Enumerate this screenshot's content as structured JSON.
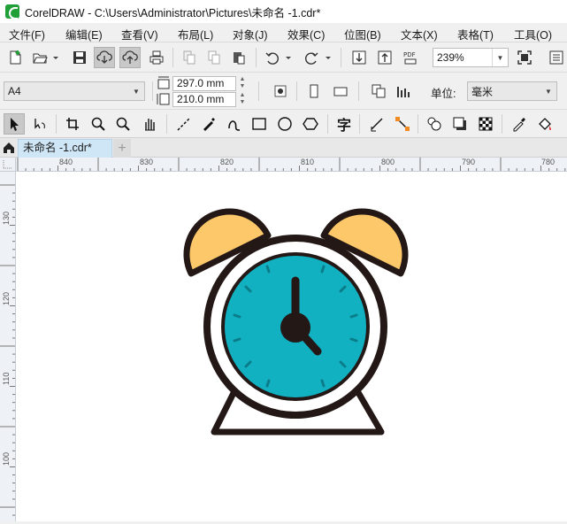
{
  "window": {
    "title": "CorelDRAW - C:\\Users\\Administrator\\Pictures\\未命名 -1.cdr*"
  },
  "menu": [
    "文件(F)",
    "编辑(E)",
    "查看(V)",
    "布局(L)",
    "对象(J)",
    "效果(C)",
    "位图(B)",
    "文本(X)",
    "表格(T)",
    "工具(O)"
  ],
  "standard_toolbar": {
    "zoom": "239%"
  },
  "property_bar": {
    "page_size": "A4",
    "width": "297.0 mm",
    "height": "210.0 mm",
    "units_label": "单位:",
    "units_value": "毫米"
  },
  "toolbox": {
    "text_tool_glyph": "字"
  },
  "tabs": {
    "document": "未命名 -1.cdr*",
    "add": "+"
  },
  "rulers": {
    "horizontal": [
      "840",
      "830",
      "820",
      "810",
      "800",
      "790",
      "780"
    ],
    "vertical": [
      "130",
      "120",
      "110",
      "100"
    ]
  },
  "drawing": {
    "subject": "alarm clock",
    "colors": {
      "outline": "#231815",
      "bells": "#fdc86a",
      "face": "#12b1c2",
      "body": "#ffffff",
      "tick": "#0b7c89"
    }
  }
}
